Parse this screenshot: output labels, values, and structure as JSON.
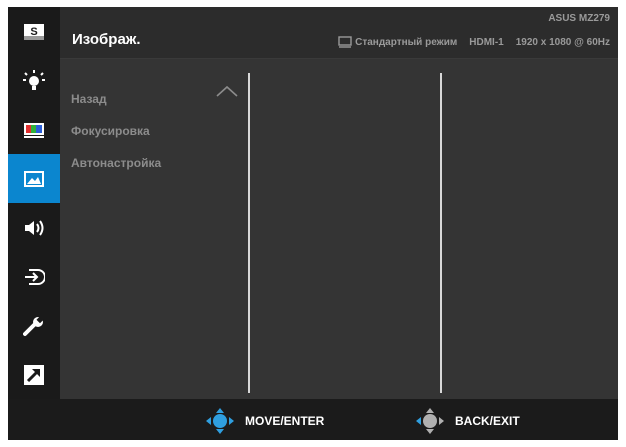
{
  "header": {
    "title": "Изображ.",
    "model": "ASUS MZ279",
    "mode": "Стандартный режим",
    "input": "HDMI-1",
    "resolution": "1920 x 1080 @ 60Hz"
  },
  "menu": {
    "items": [
      {
        "label": "Назад"
      },
      {
        "label": "Фокусировка"
      },
      {
        "label": "Автонастройка"
      }
    ]
  },
  "sidebar": {
    "active_index": 3,
    "icons": [
      "splendid-icon",
      "brightness-icon",
      "color-icon",
      "image-icon",
      "sound-icon",
      "input-select-icon",
      "system-setup-icon",
      "shortcut-icon"
    ],
    "active_color": "#0b86cf"
  },
  "footer": {
    "move_label": "MOVE/ENTER",
    "back_label": "BACK/EXIT"
  }
}
